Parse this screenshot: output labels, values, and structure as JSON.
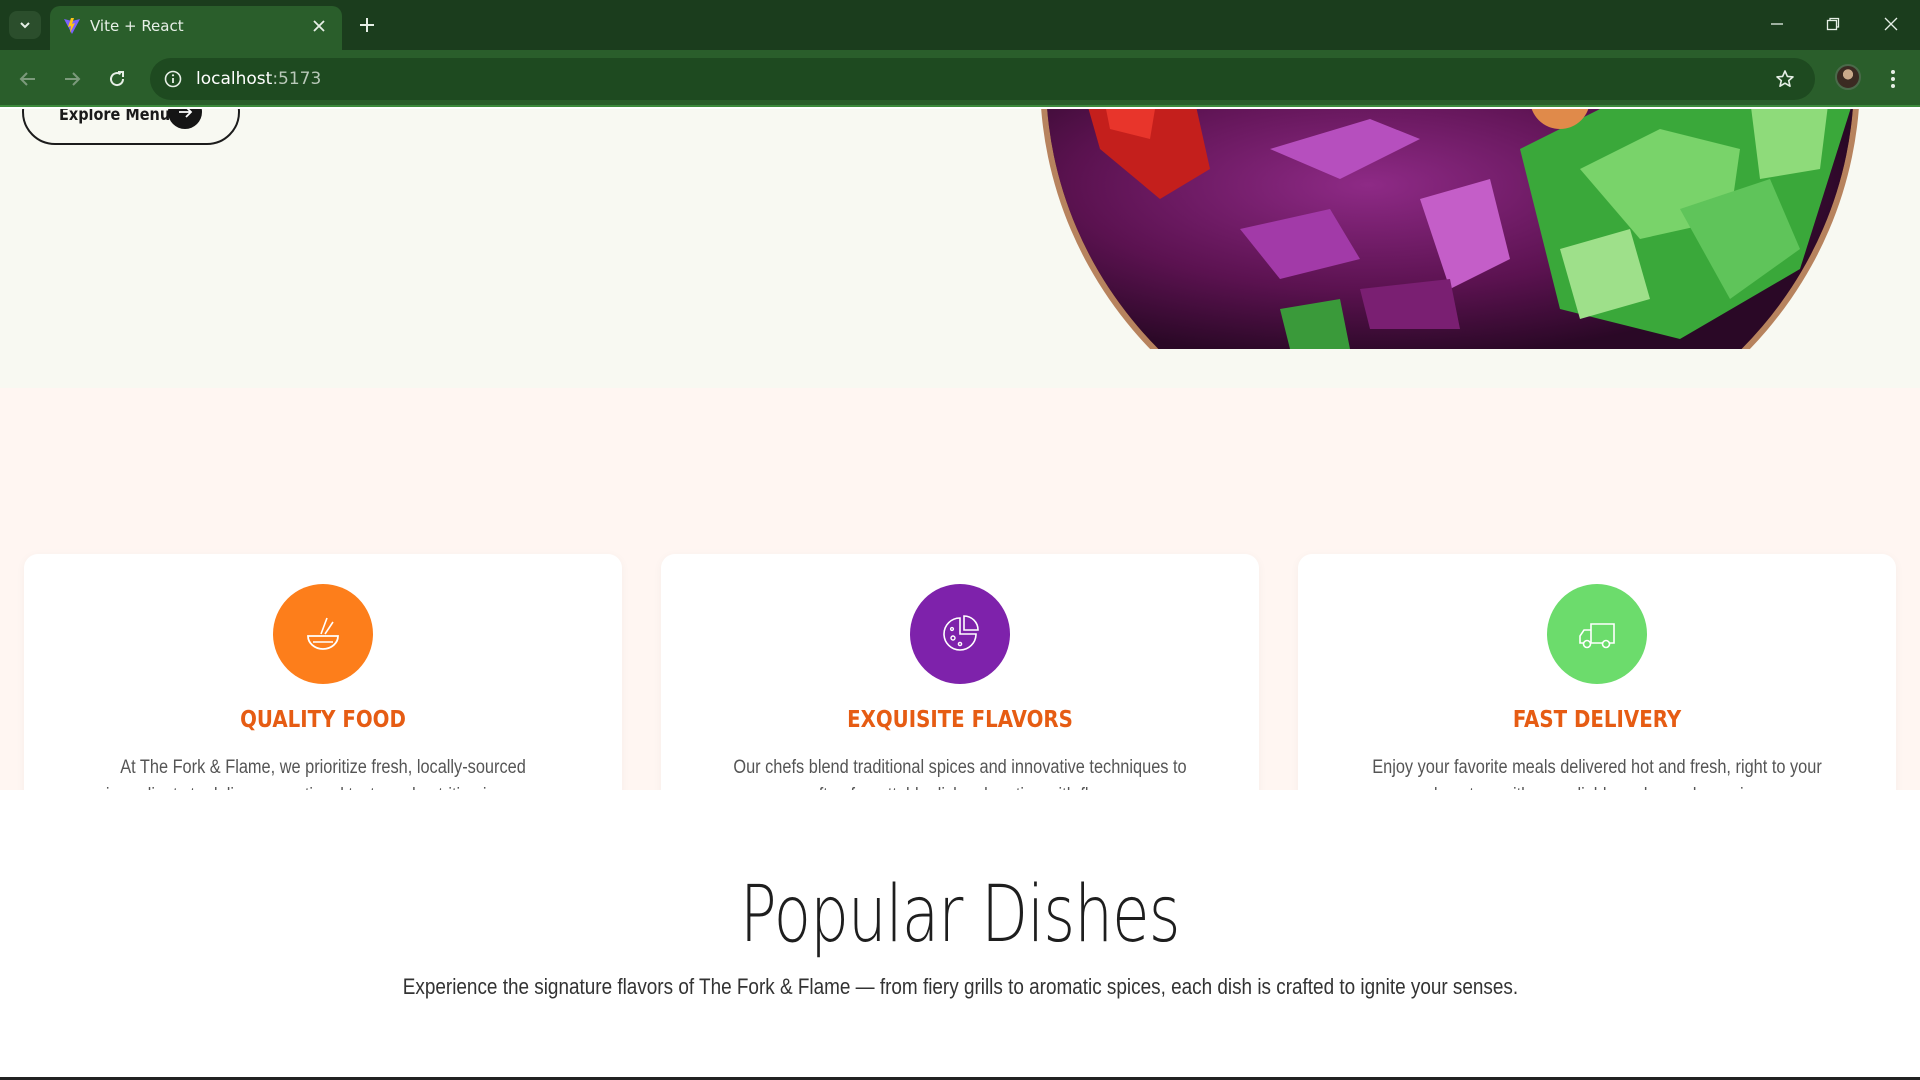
{
  "browser": {
    "tab_title": "Vite + React",
    "url_host": "localhost",
    "url_port": ":5173"
  },
  "hero": {
    "explore_label": "Explore Menu"
  },
  "features": [
    {
      "title": "QUALITY FOOD",
      "description": "At The Fork & Flame, we prioritize fresh, locally-sourced ingredients to deliver exceptional taste and nutrition in every bite.",
      "icon": "bowl-icon",
      "color": "#fd7e1b"
    },
    {
      "title": "EXQUISITE FLAVORS",
      "description": "Our chefs blend traditional spices and innovative techniques to craft unforgettable dishes bursting with flavor.",
      "icon": "pizza-icon",
      "color": "#7e22ab"
    },
    {
      "title": "FAST DELIVERY",
      "description": "Enjoy your favorite meals delivered hot and fresh, right to your doorstep, with our reliable and speedy service.",
      "icon": "truck-icon",
      "color": "#6cdc6c"
    }
  ],
  "popular": {
    "title": "Popular Dishes",
    "subtitle": "Experience the signature flavors of The Fork & Flame — from fiery grills to aromatic spices, each dish is crafted to ignite your senses."
  },
  "theme": {
    "accent": "#e65c13",
    "chrome_dark": "#1b3d1d",
    "chrome": "#2a5e2b"
  }
}
